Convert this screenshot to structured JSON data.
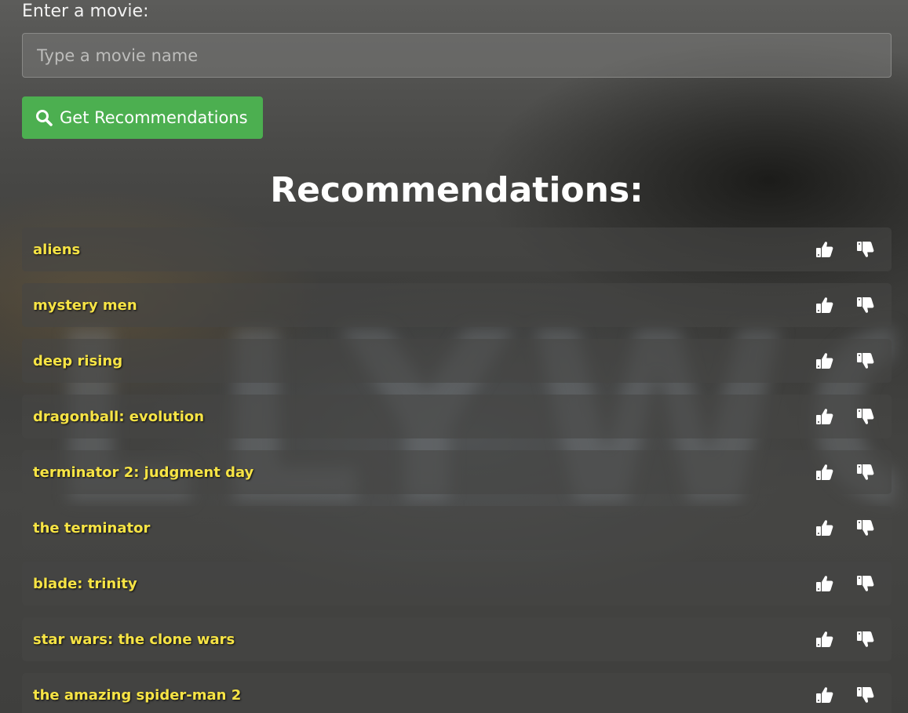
{
  "form": {
    "label": "Enter a movie:",
    "input_value": "",
    "input_placeholder": "Type a movie name",
    "button_label": "Get Recommendations",
    "button_icon": "search-icon"
  },
  "recommendations": {
    "heading": "Recommendations:",
    "items": [
      {
        "title": "aliens"
      },
      {
        "title": "mystery men"
      },
      {
        "title": "deep rising"
      },
      {
        "title": "dragonball: evolution"
      },
      {
        "title": "terminator 2: judgment day"
      },
      {
        "title": "the terminator"
      },
      {
        "title": "blade: trinity"
      },
      {
        "title": "star wars: the clone wars"
      },
      {
        "title": "the amazing spider-man 2"
      }
    ],
    "like_icon": "thumbs-up-icon",
    "dislike_icon": "thumbs-down-icon"
  },
  "colors": {
    "button_green": "#4caf50",
    "title_yellow": "#f7e445"
  }
}
